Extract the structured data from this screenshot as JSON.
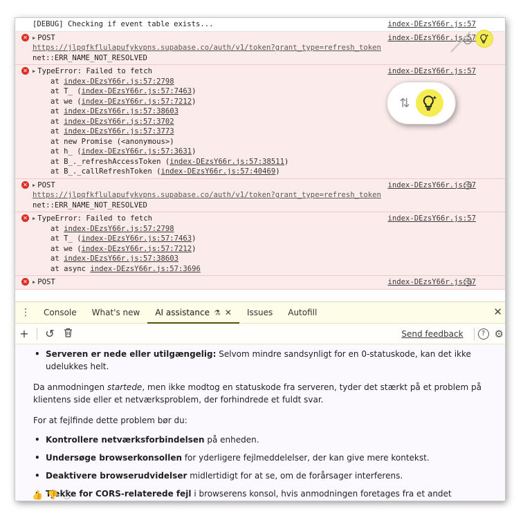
{
  "console": {
    "messages": [
      {
        "level": "debug",
        "text": "[DEBUG] Checking if event table exists...",
        "source": "index-DEzsY66r.js:57"
      },
      {
        "level": "error",
        "title": "POST",
        "url": "https://jlpqfkflulapufykvpns.supabase.co/auth/v1/token?grant_type=refresh_token",
        "detail": "net::ERR_NAME_NOT_RESOLVED",
        "source": "index-DEzsY66r.js:57"
      },
      {
        "level": "error",
        "title": "TypeError: Failed to fetch",
        "source": "index-DEzsY66r.js:57",
        "stack": [
          {
            "prefix": "at ",
            "link": "index-DEzsY66r.js:57:2798"
          },
          {
            "prefix": "at T_ (",
            "link": "index-DEzsY66r.js:57:7463",
            "suffix": ")"
          },
          {
            "prefix": "at we (",
            "link": "index-DEzsY66r.js:57:7212",
            "suffix": ")"
          },
          {
            "prefix": "at ",
            "link": "index-DEzsY66r.js:57:38603"
          },
          {
            "prefix": "at ",
            "link": "index-DEzsY66r.js:57:3702"
          },
          {
            "prefix": "at ",
            "link": "index-DEzsY66r.js:57:3773"
          },
          {
            "prefix": "at new Promise (<anonymous>)"
          },
          {
            "prefix": "at h_ (",
            "link": "index-DEzsY66r.js:57:3631",
            "suffix": ")"
          },
          {
            "prefix": "at B_._refreshAccessToken (",
            "link": "index-DEzsY66r.js:57:38511",
            "suffix": ")"
          },
          {
            "prefix": "at B_._callRefreshToken (",
            "link": "index-DEzsY66r.js:57:40469",
            "suffix": ")"
          }
        ]
      },
      {
        "level": "error",
        "title": "POST",
        "url": "https://jlpqfkflulapufykvpns.supabase.co/auth/v1/token?grant_type=refresh_token",
        "detail": "net::ERR_NAME_NOT_RESOLVED",
        "source": "index-DEzsY66r.js:57"
      },
      {
        "level": "error",
        "title": "TypeError: Failed to fetch",
        "source": "index-DEzsY66r.js:57",
        "stack": [
          {
            "prefix": "at ",
            "link": "index-DEzsY66r.js:57:2798"
          },
          {
            "prefix": "at T_ (",
            "link": "index-DEzsY66r.js:57:7463",
            "suffix": ")"
          },
          {
            "prefix": "at we (",
            "link": "index-DEzsY66r.js:57:7212",
            "suffix": ")"
          },
          {
            "prefix": "at ",
            "link": "index-DEzsY66r.js:57:38603"
          },
          {
            "prefix": "at async ",
            "link": "index-DEzsY66r.js:57:3696"
          }
        ]
      },
      {
        "level": "error",
        "title": "POST",
        "source": "index-DEzsY66r.js:57"
      }
    ]
  },
  "drawer": {
    "tabs": [
      {
        "label": "Console"
      },
      {
        "label": "What's new"
      },
      {
        "label": "AI assistance",
        "active": true
      },
      {
        "label": "Issues"
      },
      {
        "label": "Autofill"
      }
    ],
    "toolbar": {
      "send_feedback": "Send feedback"
    }
  },
  "chat": {
    "cut_bullet_bold": "Serveren er nede eller utilgængelig:",
    "cut_bullet_rest": " Selvom mindre sandsynligt for en 0-statuskode, kan det ikke udelukkes helt.",
    "para1_a": "Da anmodningen ",
    "para1_em": "startede",
    "para1_b": ", men ikke modtog en statuskode fra serveren, tyder det stærkt på et problem på klientens side eller et netværksproblem, der forhindrede et fuldt svar.",
    "para2": "For at fejlfinde dette problem bør du:",
    "bullets": [
      {
        "bold": "Kontrollere netværksforbindelsen",
        "rest": " på enheden."
      },
      {
        "bold": "Undersøge browserkonsollen",
        "rest": " for yderligere fejlmeddelelser, der kan give mere kontekst."
      },
      {
        "bold": "Deaktivere browserudvidelser",
        "rest": " midlertidigt for at se, om de forårsager interferens."
      },
      {
        "bold": "Tjekke for CORS-relaterede fejl",
        "rest": " i browserens konsol, hvis anmodningen foretages fra et andet domæne."
      }
    ]
  },
  "colors": {
    "accent": "#f5ec53",
    "error": "#d93025",
    "error_bg": "#fcebeb"
  }
}
